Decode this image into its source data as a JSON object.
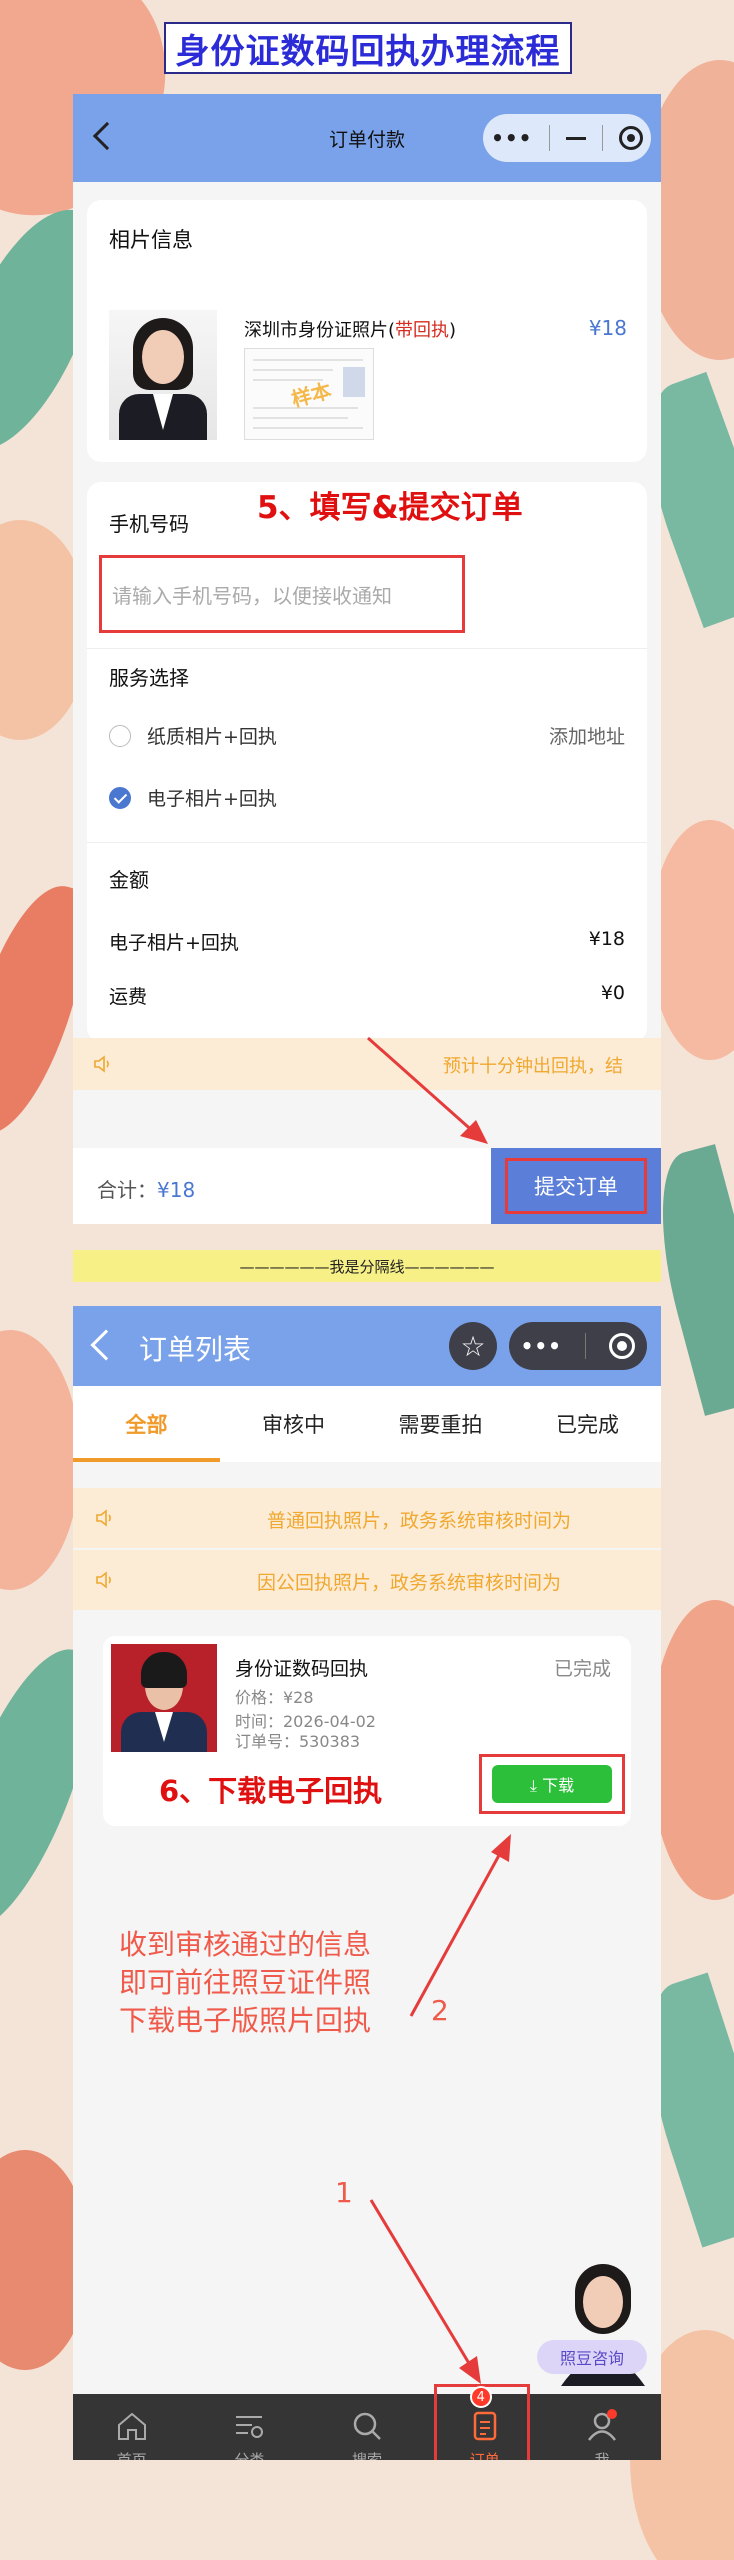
{
  "header": {
    "title": "身份证数码回执办理流程"
  },
  "order_pay": {
    "nav_title": "订单付款",
    "photo_info": {
      "section_title": "相片信息",
      "product_name": "深圳市身份证照片",
      "product_tag_prefix": "(",
      "product_tag": "带回执",
      "product_tag_suffix": ")",
      "price": "¥18",
      "sample_stamp": "样本"
    },
    "step5_label": "5、填写&提交订单",
    "phone": {
      "label": "手机号码",
      "placeholder": "请输入手机号码，以便接收通知"
    },
    "service": {
      "label": "服务选择",
      "options": [
        {
          "label": "纸质相片+回执",
          "selected": false,
          "extra": "添加地址"
        },
        {
          "label": "电子相片+回执",
          "selected": true,
          "extra": ""
        }
      ]
    },
    "amount": {
      "label": "金额",
      "rows": [
        {
          "name": "电子相片+回执",
          "value": "¥18"
        },
        {
          "name": "运费",
          "value": "¥0"
        }
      ]
    },
    "notice": "预计十分钟出回执，结",
    "total_label": "合计：",
    "total_value": "¥18",
    "submit_label": "提交订单"
  },
  "separator": "——————我是分隔线——————",
  "order_list": {
    "nav_title": "订单列表",
    "tabs": [
      "全部",
      "审核中",
      "需要重拍",
      "已完成"
    ],
    "active_tab": 0,
    "notices": [
      "普通回执照片，政务系统审核时间为",
      "因公回执照片，政务系统审核时间为"
    ],
    "order": {
      "name": "身份证数码回执",
      "status": "已完成",
      "price": "价格：¥28",
      "time": "时间：2026-04-02",
      "number": "订单号：530383",
      "download_label": "⤓ 下载"
    },
    "step6_label": "6、下载电子回执",
    "caption_lines": [
      "收到审核通过的信息",
      "即可前往照豆证件照",
      "下载电子版照片回执"
    ],
    "step_numbers": [
      "2",
      "1"
    ],
    "cs_label": "照豆咨询",
    "tabbar": [
      {
        "label": "首页",
        "icon": "home-icon"
      },
      {
        "label": "分类",
        "icon": "category-icon"
      },
      {
        "label": "搜索",
        "icon": "search-icon"
      },
      {
        "label": "订单",
        "icon": "order-icon",
        "badge": "4"
      },
      {
        "label": "我",
        "icon": "user-icon"
      }
    ]
  },
  "colors": {
    "accent": "#7aa2ea",
    "highlight_red": "#e53b3b",
    "orange": "#f09a2a",
    "download_green": "#2bbf3a"
  }
}
